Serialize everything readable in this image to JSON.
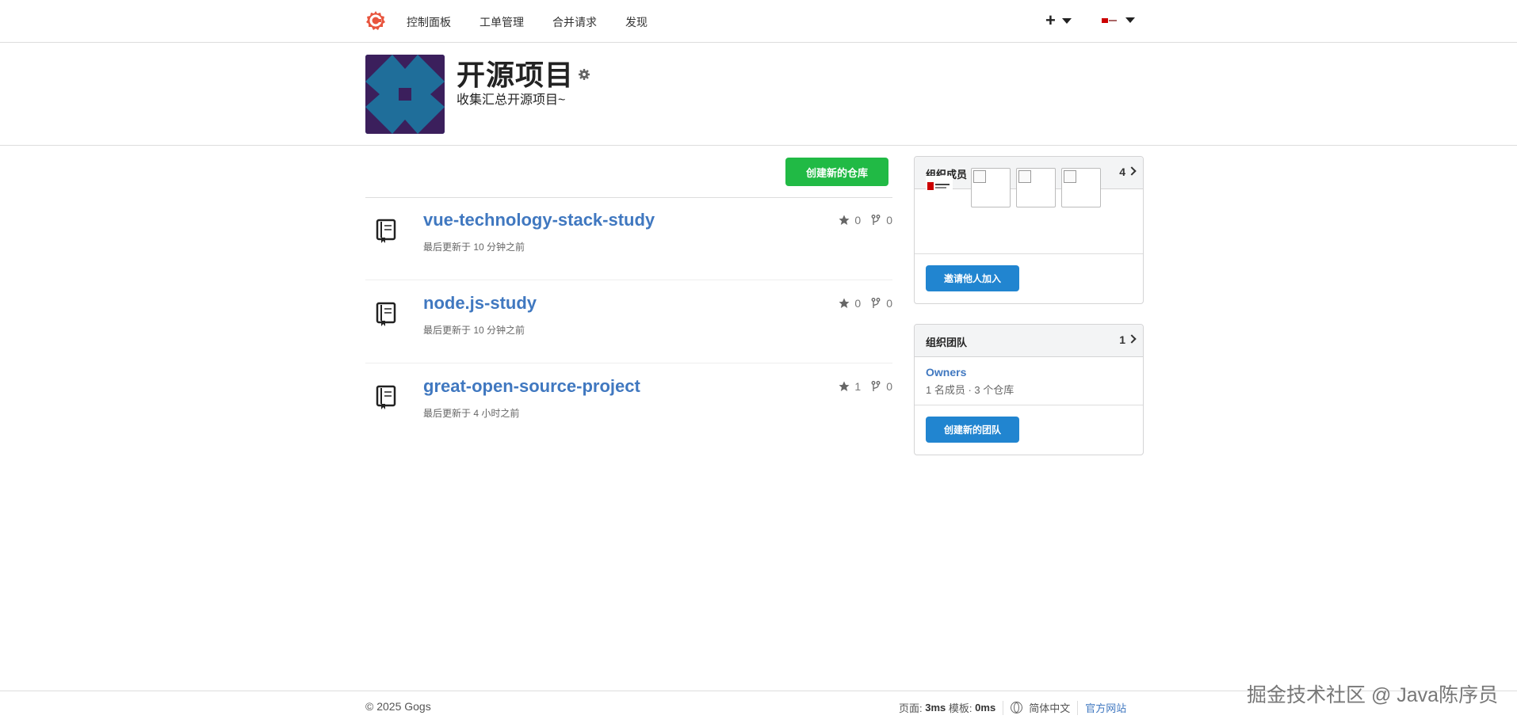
{
  "nav": {
    "items": [
      "控制面板",
      "工单管理",
      "合并请求",
      "发现"
    ],
    "plus_icon": "plus-icon",
    "accent": "#e8553e"
  },
  "org": {
    "title": "开源项目",
    "description": "收集汇总开源项目~"
  },
  "repos": {
    "create_label": "创建新的仓库",
    "items": [
      {
        "name": "vue-technology-stack-study",
        "updated": "最后更新于 10 分钟之前",
        "stars": "0",
        "forks": "0"
      },
      {
        "name": "node.js-study",
        "updated": "最后更新于 10 分钟之前",
        "stars": "0",
        "forks": "0"
      },
      {
        "name": "great-open-source-project",
        "updated": "最后更新于 4 小时之前",
        "stars": "1",
        "forks": "0"
      }
    ]
  },
  "members": {
    "title": "组织成员",
    "count": "4",
    "invite_label": "邀请他人加入"
  },
  "teams": {
    "title": "组织团队",
    "count": "1",
    "team_name": "Owners",
    "team_meta": "1 名成员 · 3 个仓库",
    "create_label": "创建新的团队"
  },
  "footer": {
    "copyright": "© 2025 Gogs",
    "page_label": "页面:",
    "page_time": "3ms",
    "template_label": "模板:",
    "template_time": "0ms",
    "language": "简体中文",
    "official": "官方网站"
  },
  "watermark": "掘金技术社区 @ Java陈序员",
  "colors": {
    "green": "#21ba45",
    "blue": "#2185d0",
    "link": "#4078c0"
  }
}
